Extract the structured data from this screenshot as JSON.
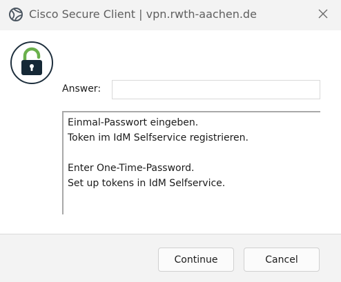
{
  "window": {
    "title": "Cisco Secure Client | vpn.rwth-aachen.de"
  },
  "icons": {
    "app": "cisco-globe-icon",
    "close": "close-icon",
    "lock": "lock-icon"
  },
  "colors": {
    "lock_shackle": "#6ab04c",
    "lock_body": "#152836",
    "badge_border": "#1e2f3d"
  },
  "form": {
    "answer_label": "Answer:",
    "answer_value": "",
    "answer_placeholder": ""
  },
  "message": {
    "lines": [
      "Einmal-Passwort eingeben.",
      "Token im IdM Selfservice registrieren.",
      "",
      "Enter One-Time-Password.",
      "Set up tokens in IdM Selfservice."
    ]
  },
  "buttons": {
    "continue": "Continue",
    "cancel": "Cancel"
  }
}
